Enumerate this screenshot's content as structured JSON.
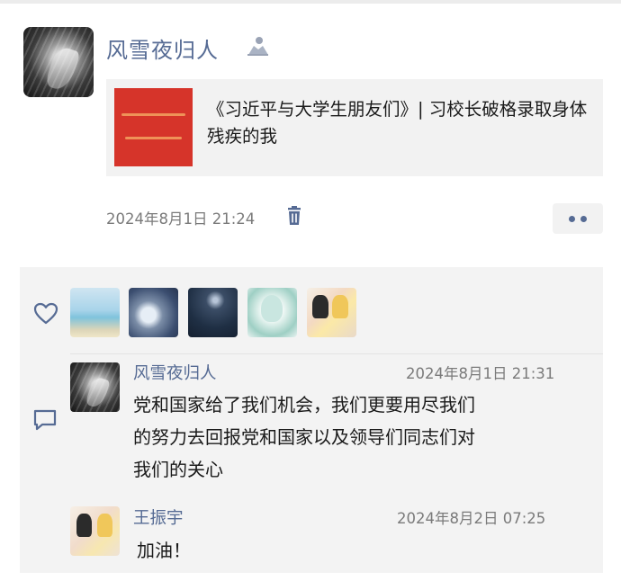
{
  "post": {
    "author": "风雪夜归人",
    "badge_icon": "user-badge-icon",
    "link": {
      "title": "《习近平与大学生朋友们》| 习校长破格录取身体残疾的我",
      "thumbnail_color": "#d6342a"
    },
    "time": "2024年8月1日 21:24",
    "delete_icon": "trash-icon",
    "more_icon": "more-dots-icon"
  },
  "likes": {
    "icon": "heart-icon",
    "avatars": [
      "liker-avatar-1",
      "liker-avatar-2",
      "liker-avatar-3",
      "liker-avatar-4",
      "liker-avatar-5"
    ]
  },
  "comments": {
    "icon": "comment-icon",
    "items": [
      {
        "name": "风雪夜归人",
        "time": "2024年8月1日 21:31",
        "lines": [
          "党和国家给了我们机会，我们更要用尽我们",
          "的努力去回报党和国家以及领导们同志们对",
          "我们的关心"
        ]
      },
      {
        "name": "王振宇",
        "time": "2024年8月2日 07:25",
        "lines": [
          "加油！"
        ]
      }
    ]
  },
  "colors": {
    "name_blue": "#566b94",
    "time_gray": "#7a7a7a",
    "card_bg": "#f2f2f2",
    "panel_bg": "#f3f3f3"
  }
}
